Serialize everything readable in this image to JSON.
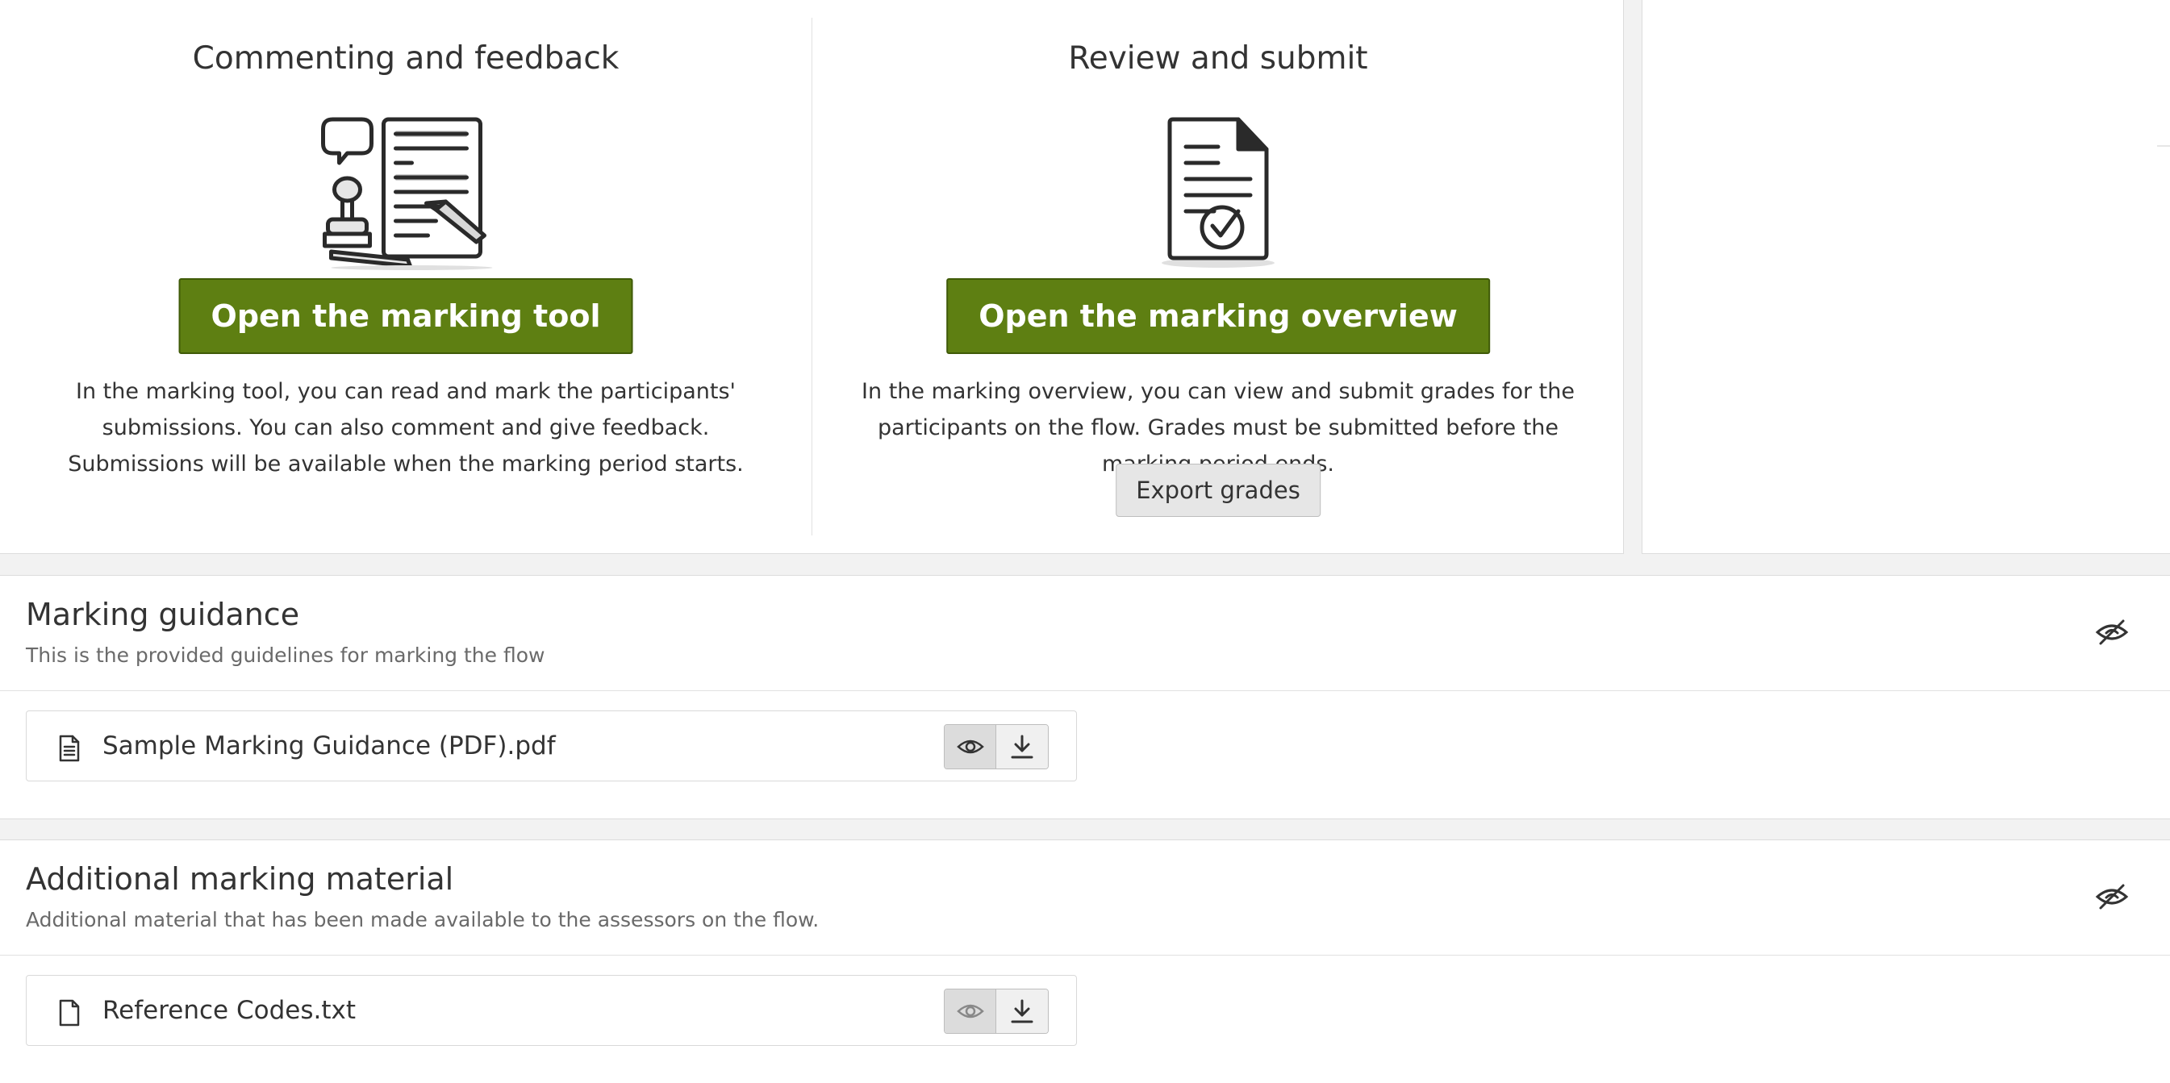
{
  "commenting": {
    "title": "Commenting and feedback",
    "button_label": "Open the marking tool",
    "description": "In the marking tool, you can read and mark the participants' submissions. You can also comment and give feedback. Submissions will be available when the marking period starts."
  },
  "review": {
    "title": "Review and submit",
    "button_label": "Open the marking overview",
    "description": "In the marking overview, you can view and submit grades for the participants on the flow. Grades must be submitted before the marking period ends.",
    "export_label": "Export grades"
  },
  "marking_guidance": {
    "title": "Marking guidance",
    "subtitle": "This is the provided guidelines for marking the flow",
    "file": {
      "name": "Sample Marking Guidance (PDF).pdf",
      "icon": "document-icon"
    }
  },
  "additional_material": {
    "title": "Additional marking material",
    "subtitle": "Additional material that has been made available to the assessors on the flow.",
    "file": {
      "name": "Reference Codes.txt",
      "icon": "file-icon"
    }
  },
  "colors": {
    "primary": "#5e7f12",
    "primary_border": "#3f5a08",
    "background": "#f2f2f2"
  }
}
